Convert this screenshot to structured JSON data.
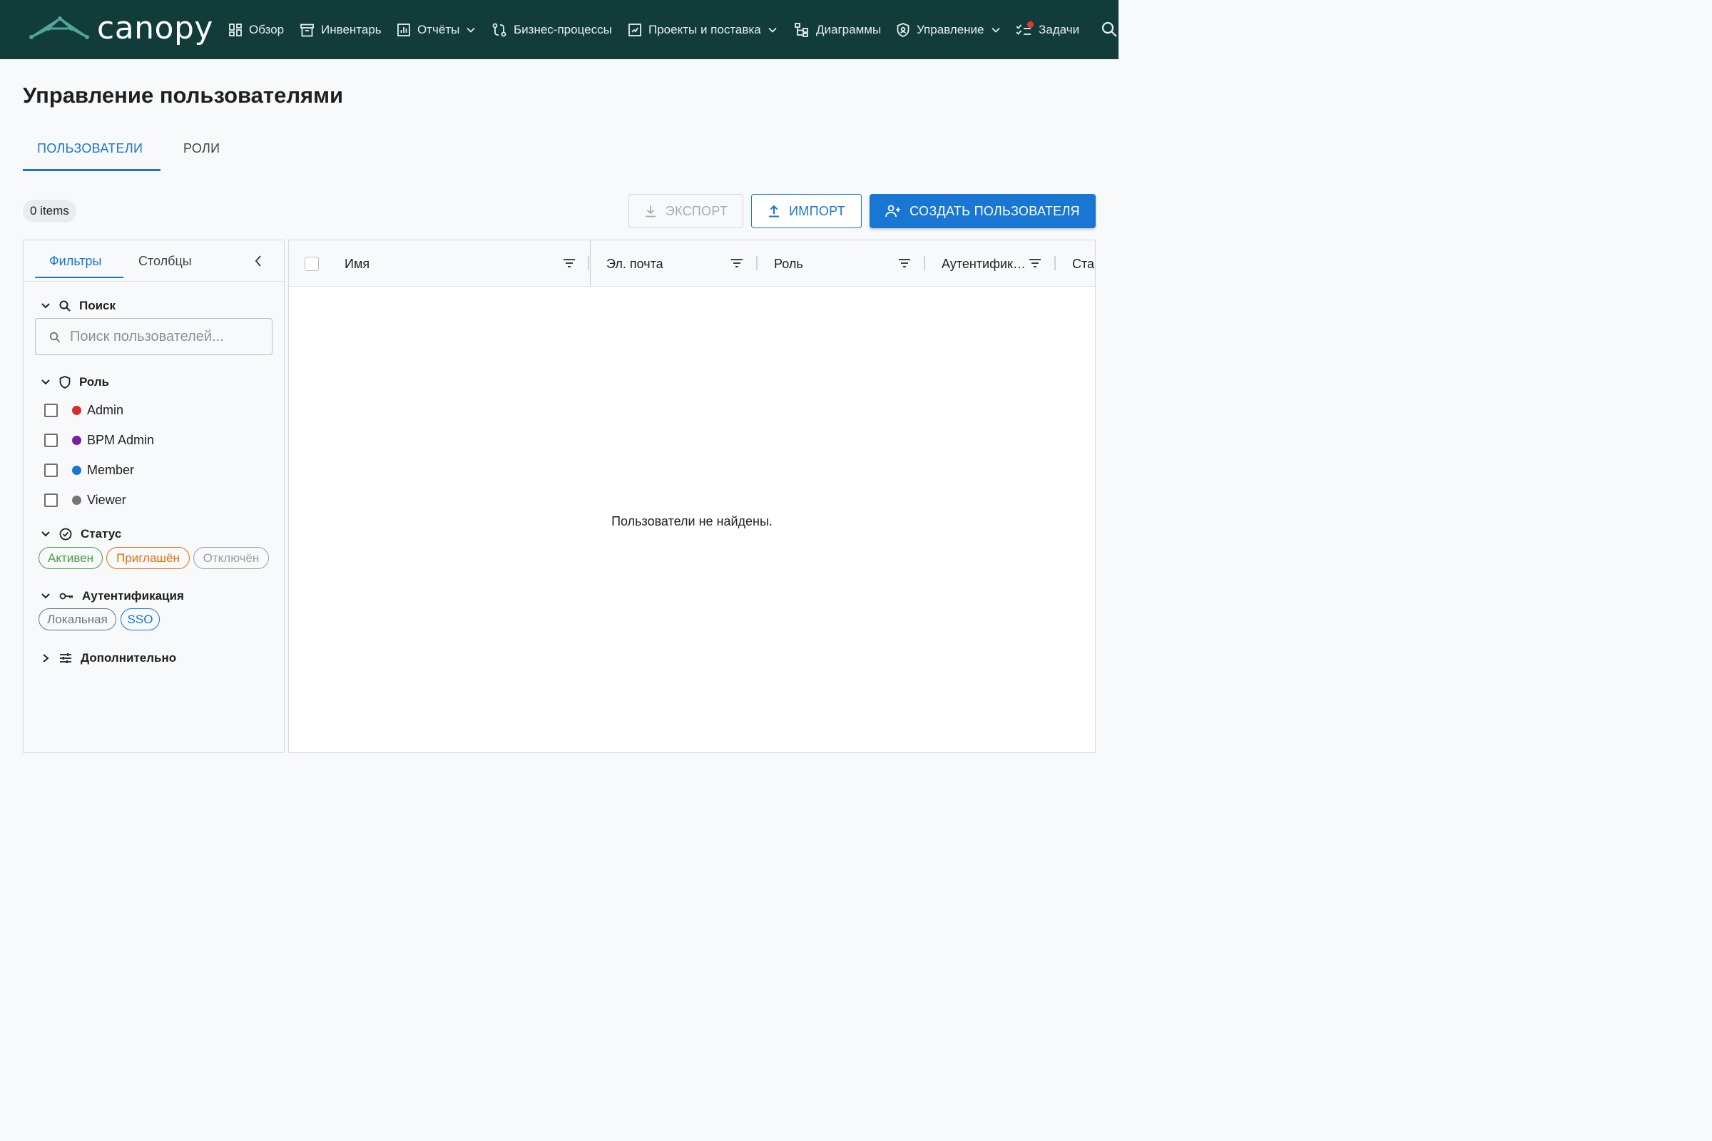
{
  "app": {
    "logo_text": "canopy"
  },
  "nav": {
    "overview": "Обзор",
    "inventory": "Инвентарь",
    "reports": "Отчёты",
    "business_processes": "Бизнес-процессы",
    "projects": "Проекты и поставка",
    "diagrams": "Диаграммы",
    "management": "Управление",
    "tasks": "Задачи"
  },
  "page": {
    "title": "Управление пользователями",
    "tabs": {
      "users": "ПОЛЬЗОВАТЕЛИ",
      "roles": "РОЛИ"
    },
    "item_count": "0 items"
  },
  "actions": {
    "export": "ЭКСПОРТ",
    "import": "ИМПОРТ",
    "create_user": "СОЗДАТЬ ПОЛЬЗОВАТЕЛЯ"
  },
  "sidebar": {
    "tab_filters": "Фильтры",
    "tab_columns": "Столбцы",
    "search": {
      "title": "Поиск",
      "placeholder": "Поиск пользователей...",
      "value": ""
    },
    "role": {
      "title": "Роль",
      "options": [
        {
          "label": "Admin",
          "color": "#d32f2f"
        },
        {
          "label": "BPM Admin",
          "color": "#7b1fa2"
        },
        {
          "label": "Member",
          "color": "#1976d2"
        },
        {
          "label": "Viewer",
          "color": "#757575"
        }
      ]
    },
    "status": {
      "title": "Статус",
      "chips": [
        {
          "label": "Активен",
          "color": "#43a047"
        },
        {
          "label": "Приглашён",
          "color": "#ef6c00"
        },
        {
          "label": "Отключён",
          "color": "#9e9e9e"
        }
      ]
    },
    "auth": {
      "title": "Аутентификация",
      "chips": [
        {
          "label": "Локальная",
          "color": "#6b7480"
        },
        {
          "label": "SSO",
          "color": "#1976d2"
        }
      ]
    },
    "advanced": {
      "title": "Дополнительно"
    }
  },
  "grid": {
    "columns": [
      "Имя",
      "Эл. почта",
      "Роль",
      "Аутентифик…",
      "Ста"
    ],
    "empty_message": "Пользователи не найдены."
  },
  "colors": {
    "topbar": "#123c3a",
    "accent": "#1976d2",
    "notification": "#e53935"
  }
}
